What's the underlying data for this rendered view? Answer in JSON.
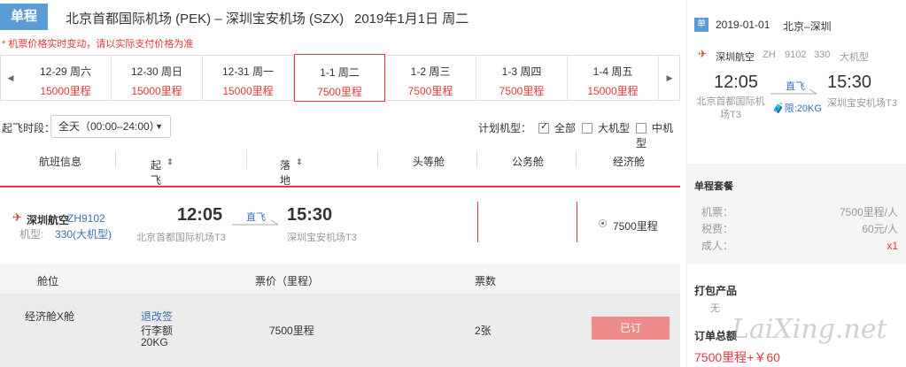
{
  "header": {
    "badge": "单程",
    "route": "北京首都国际机场 (PEK) – 深圳宝安机场 (SZX)",
    "date": "2019年1月1日 周二",
    "warning": "* 机票价格实时变动，请以实际支付价格为准"
  },
  "dates": [
    {
      "date": "12-29 周六",
      "price": "15000里程"
    },
    {
      "date": "12-30 周日",
      "price": "15000里程"
    },
    {
      "date": "12-31 周一",
      "price": "15000里程"
    },
    {
      "date": "1-1 周二",
      "price": "7500里程"
    },
    {
      "date": "1-2 周三",
      "price": "7500里程"
    },
    {
      "date": "1-3 周四",
      "price": "7500里程"
    },
    {
      "date": "1-4 周五",
      "price": "15000里程"
    }
  ],
  "filter": {
    "time_label": "起飞时段：",
    "time_value": "全天（00:00–24:00）",
    "aircraft_label": "计划机型：",
    "opt_all": "全部",
    "opt_large": "大机型",
    "opt_medium": "中机型"
  },
  "columns": {
    "flight_info": "航班信息",
    "depart_time": "起飞时间",
    "arrive_time": "落地时间",
    "first": "头等舱",
    "business": "公务舱",
    "economy": "经济舱"
  },
  "flight": {
    "airline": "深圳航空",
    "flight_no": "ZH9102",
    "aircraft_label": "机型:",
    "aircraft": "330(大机型)",
    "depart": "12:05",
    "depart_airport": "北京首都国际机场T3",
    "direct": "直飞",
    "arrive": "15:30",
    "arrive_airport": "深圳宝安机场T3",
    "economy_price": "7500里程"
  },
  "cabin_table": {
    "h_cabin": "舱位",
    "h_price": "票价（里程）",
    "h_tickets": "票数",
    "cabin": "经济舱X舱",
    "rules_link": "退改签",
    "baggage_label": "行李额",
    "baggage": "20KG",
    "price": "7500里程",
    "tickets": "2张",
    "booked": "已订"
  },
  "summary": {
    "badge": "单",
    "date": "2019-01-01",
    "route": "北京–深圳",
    "airline": "深圳航空",
    "code": "ZH",
    "flight_no": "9102",
    "aircraft": "330",
    "size": "大机型",
    "depart": "12:05",
    "direct": "直飞",
    "arrive": "15:30",
    "depart_airport": "北京首都国际机场T3",
    "baggage": "限:20KG",
    "arrive_airport": "深圳宝安机场T3",
    "package_title": "单程套餐",
    "ticket_label": "机票：",
    "ticket_value": "7500里程/人",
    "tax_label": "税费：",
    "tax_value": "60元/人",
    "adult_label": "成人：",
    "adult_value": "x1",
    "bundle_title": "打包产品",
    "bundle_value": "无",
    "total_title": "订单总额",
    "total_value": "7500里程+￥60"
  },
  "watermark": "LaiXing.net"
}
